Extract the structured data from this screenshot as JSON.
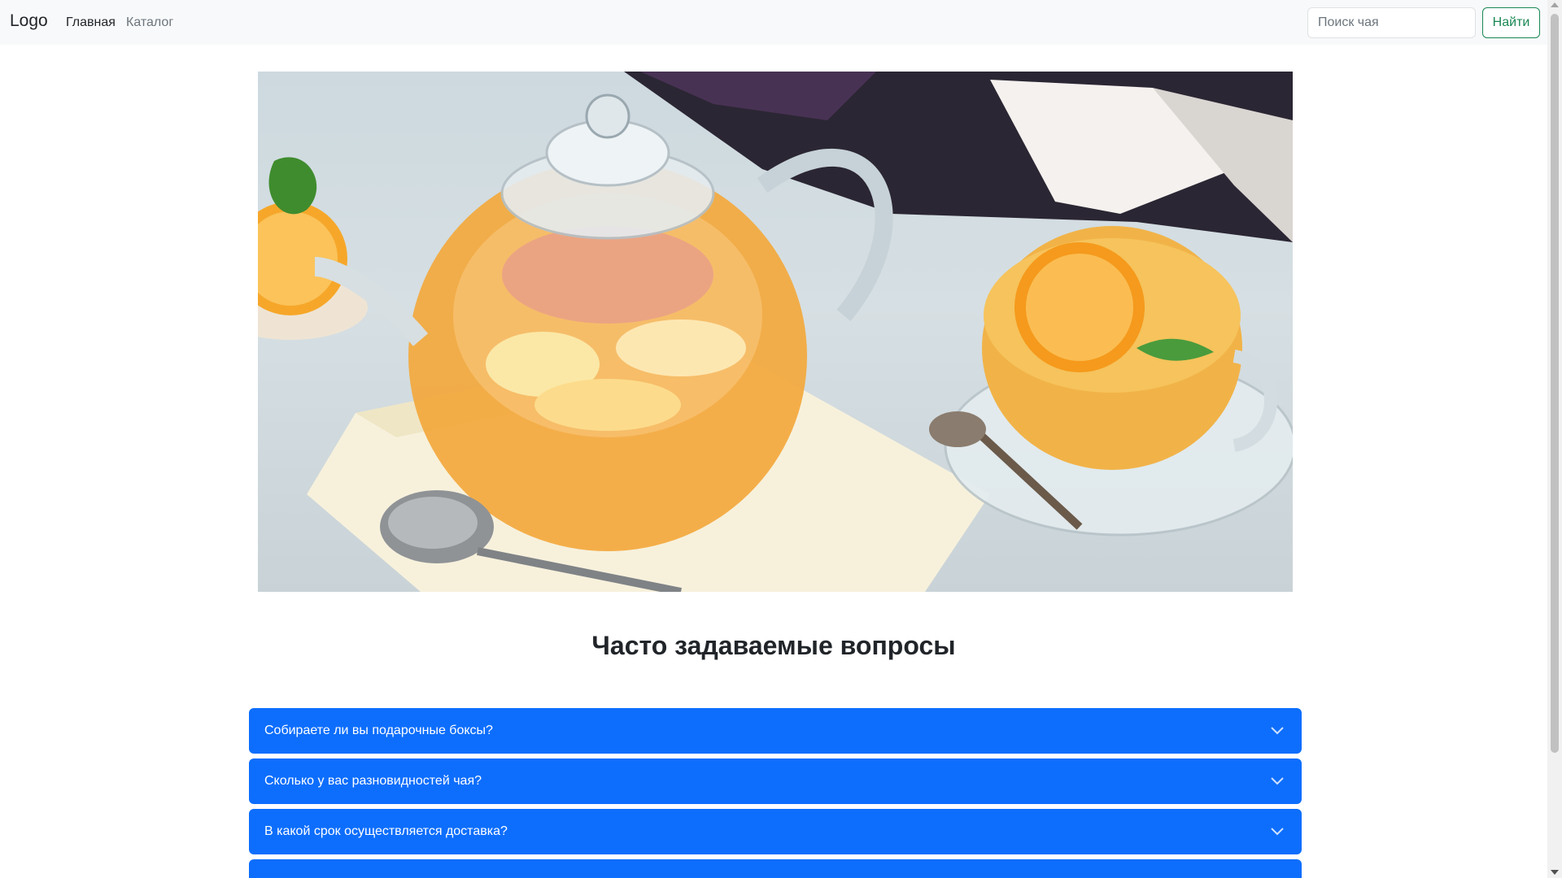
{
  "navbar": {
    "brand": "Logo",
    "links": [
      "Главная",
      "Каталог"
    ],
    "search_placeholder": "Поиск чая",
    "search_button": "Найти"
  },
  "hero": {
    "image": "tea-teapot-photo"
  },
  "faq": {
    "title": "Часто задаваемые вопросы",
    "items": [
      "Собираете ли вы подарочные боксы?",
      "Сколько у вас разновидностей чая?",
      "В какой срок осуществляется доставка?",
      ""
    ]
  },
  "colors": {
    "accordion": "#0d6efd",
    "search_button": "#198754",
    "navbar_bg": "#f8f9fa"
  }
}
